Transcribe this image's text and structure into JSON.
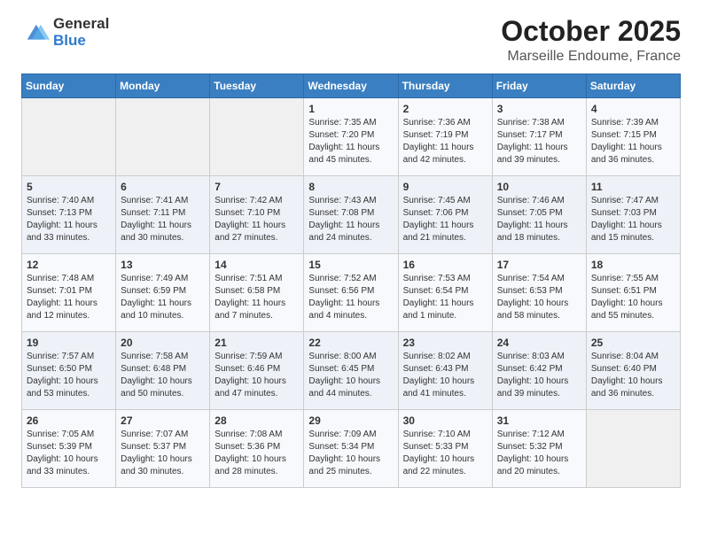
{
  "logo": {
    "general": "General",
    "blue": "Blue"
  },
  "title": "October 2025",
  "subtitle": "Marseille Endoume, France",
  "days_of_week": [
    "Sunday",
    "Monday",
    "Tuesday",
    "Wednesday",
    "Thursday",
    "Friday",
    "Saturday"
  ],
  "weeks": [
    [
      {
        "day": "",
        "info": ""
      },
      {
        "day": "",
        "info": ""
      },
      {
        "day": "",
        "info": ""
      },
      {
        "day": "1",
        "info": "Sunrise: 7:35 AM\nSunset: 7:20 PM\nDaylight: 11 hours and 45 minutes."
      },
      {
        "day": "2",
        "info": "Sunrise: 7:36 AM\nSunset: 7:19 PM\nDaylight: 11 hours and 42 minutes."
      },
      {
        "day": "3",
        "info": "Sunrise: 7:38 AM\nSunset: 7:17 PM\nDaylight: 11 hours and 39 minutes."
      },
      {
        "day": "4",
        "info": "Sunrise: 7:39 AM\nSunset: 7:15 PM\nDaylight: 11 hours and 36 minutes."
      }
    ],
    [
      {
        "day": "5",
        "info": "Sunrise: 7:40 AM\nSunset: 7:13 PM\nDaylight: 11 hours and 33 minutes."
      },
      {
        "day": "6",
        "info": "Sunrise: 7:41 AM\nSunset: 7:11 PM\nDaylight: 11 hours and 30 minutes."
      },
      {
        "day": "7",
        "info": "Sunrise: 7:42 AM\nSunset: 7:10 PM\nDaylight: 11 hours and 27 minutes."
      },
      {
        "day": "8",
        "info": "Sunrise: 7:43 AM\nSunset: 7:08 PM\nDaylight: 11 hours and 24 minutes."
      },
      {
        "day": "9",
        "info": "Sunrise: 7:45 AM\nSunset: 7:06 PM\nDaylight: 11 hours and 21 minutes."
      },
      {
        "day": "10",
        "info": "Sunrise: 7:46 AM\nSunset: 7:05 PM\nDaylight: 11 hours and 18 minutes."
      },
      {
        "day": "11",
        "info": "Sunrise: 7:47 AM\nSunset: 7:03 PM\nDaylight: 11 hours and 15 minutes."
      }
    ],
    [
      {
        "day": "12",
        "info": "Sunrise: 7:48 AM\nSunset: 7:01 PM\nDaylight: 11 hours and 12 minutes."
      },
      {
        "day": "13",
        "info": "Sunrise: 7:49 AM\nSunset: 6:59 PM\nDaylight: 11 hours and 10 minutes."
      },
      {
        "day": "14",
        "info": "Sunrise: 7:51 AM\nSunset: 6:58 PM\nDaylight: 11 hours and 7 minutes."
      },
      {
        "day": "15",
        "info": "Sunrise: 7:52 AM\nSunset: 6:56 PM\nDaylight: 11 hours and 4 minutes."
      },
      {
        "day": "16",
        "info": "Sunrise: 7:53 AM\nSunset: 6:54 PM\nDaylight: 11 hours and 1 minute."
      },
      {
        "day": "17",
        "info": "Sunrise: 7:54 AM\nSunset: 6:53 PM\nDaylight: 10 hours and 58 minutes."
      },
      {
        "day": "18",
        "info": "Sunrise: 7:55 AM\nSunset: 6:51 PM\nDaylight: 10 hours and 55 minutes."
      }
    ],
    [
      {
        "day": "19",
        "info": "Sunrise: 7:57 AM\nSunset: 6:50 PM\nDaylight: 10 hours and 53 minutes."
      },
      {
        "day": "20",
        "info": "Sunrise: 7:58 AM\nSunset: 6:48 PM\nDaylight: 10 hours and 50 minutes."
      },
      {
        "day": "21",
        "info": "Sunrise: 7:59 AM\nSunset: 6:46 PM\nDaylight: 10 hours and 47 minutes."
      },
      {
        "day": "22",
        "info": "Sunrise: 8:00 AM\nSunset: 6:45 PM\nDaylight: 10 hours and 44 minutes."
      },
      {
        "day": "23",
        "info": "Sunrise: 8:02 AM\nSunset: 6:43 PM\nDaylight: 10 hours and 41 minutes."
      },
      {
        "day": "24",
        "info": "Sunrise: 8:03 AM\nSunset: 6:42 PM\nDaylight: 10 hours and 39 minutes."
      },
      {
        "day": "25",
        "info": "Sunrise: 8:04 AM\nSunset: 6:40 PM\nDaylight: 10 hours and 36 minutes."
      }
    ],
    [
      {
        "day": "26",
        "info": "Sunrise: 7:05 AM\nSunset: 5:39 PM\nDaylight: 10 hours and 33 minutes."
      },
      {
        "day": "27",
        "info": "Sunrise: 7:07 AM\nSunset: 5:37 PM\nDaylight: 10 hours and 30 minutes."
      },
      {
        "day": "28",
        "info": "Sunrise: 7:08 AM\nSunset: 5:36 PM\nDaylight: 10 hours and 28 minutes."
      },
      {
        "day": "29",
        "info": "Sunrise: 7:09 AM\nSunset: 5:34 PM\nDaylight: 10 hours and 25 minutes."
      },
      {
        "day": "30",
        "info": "Sunrise: 7:10 AM\nSunset: 5:33 PM\nDaylight: 10 hours and 22 minutes."
      },
      {
        "day": "31",
        "info": "Sunrise: 7:12 AM\nSunset: 5:32 PM\nDaylight: 10 hours and 20 minutes."
      },
      {
        "day": "",
        "info": ""
      }
    ]
  ]
}
